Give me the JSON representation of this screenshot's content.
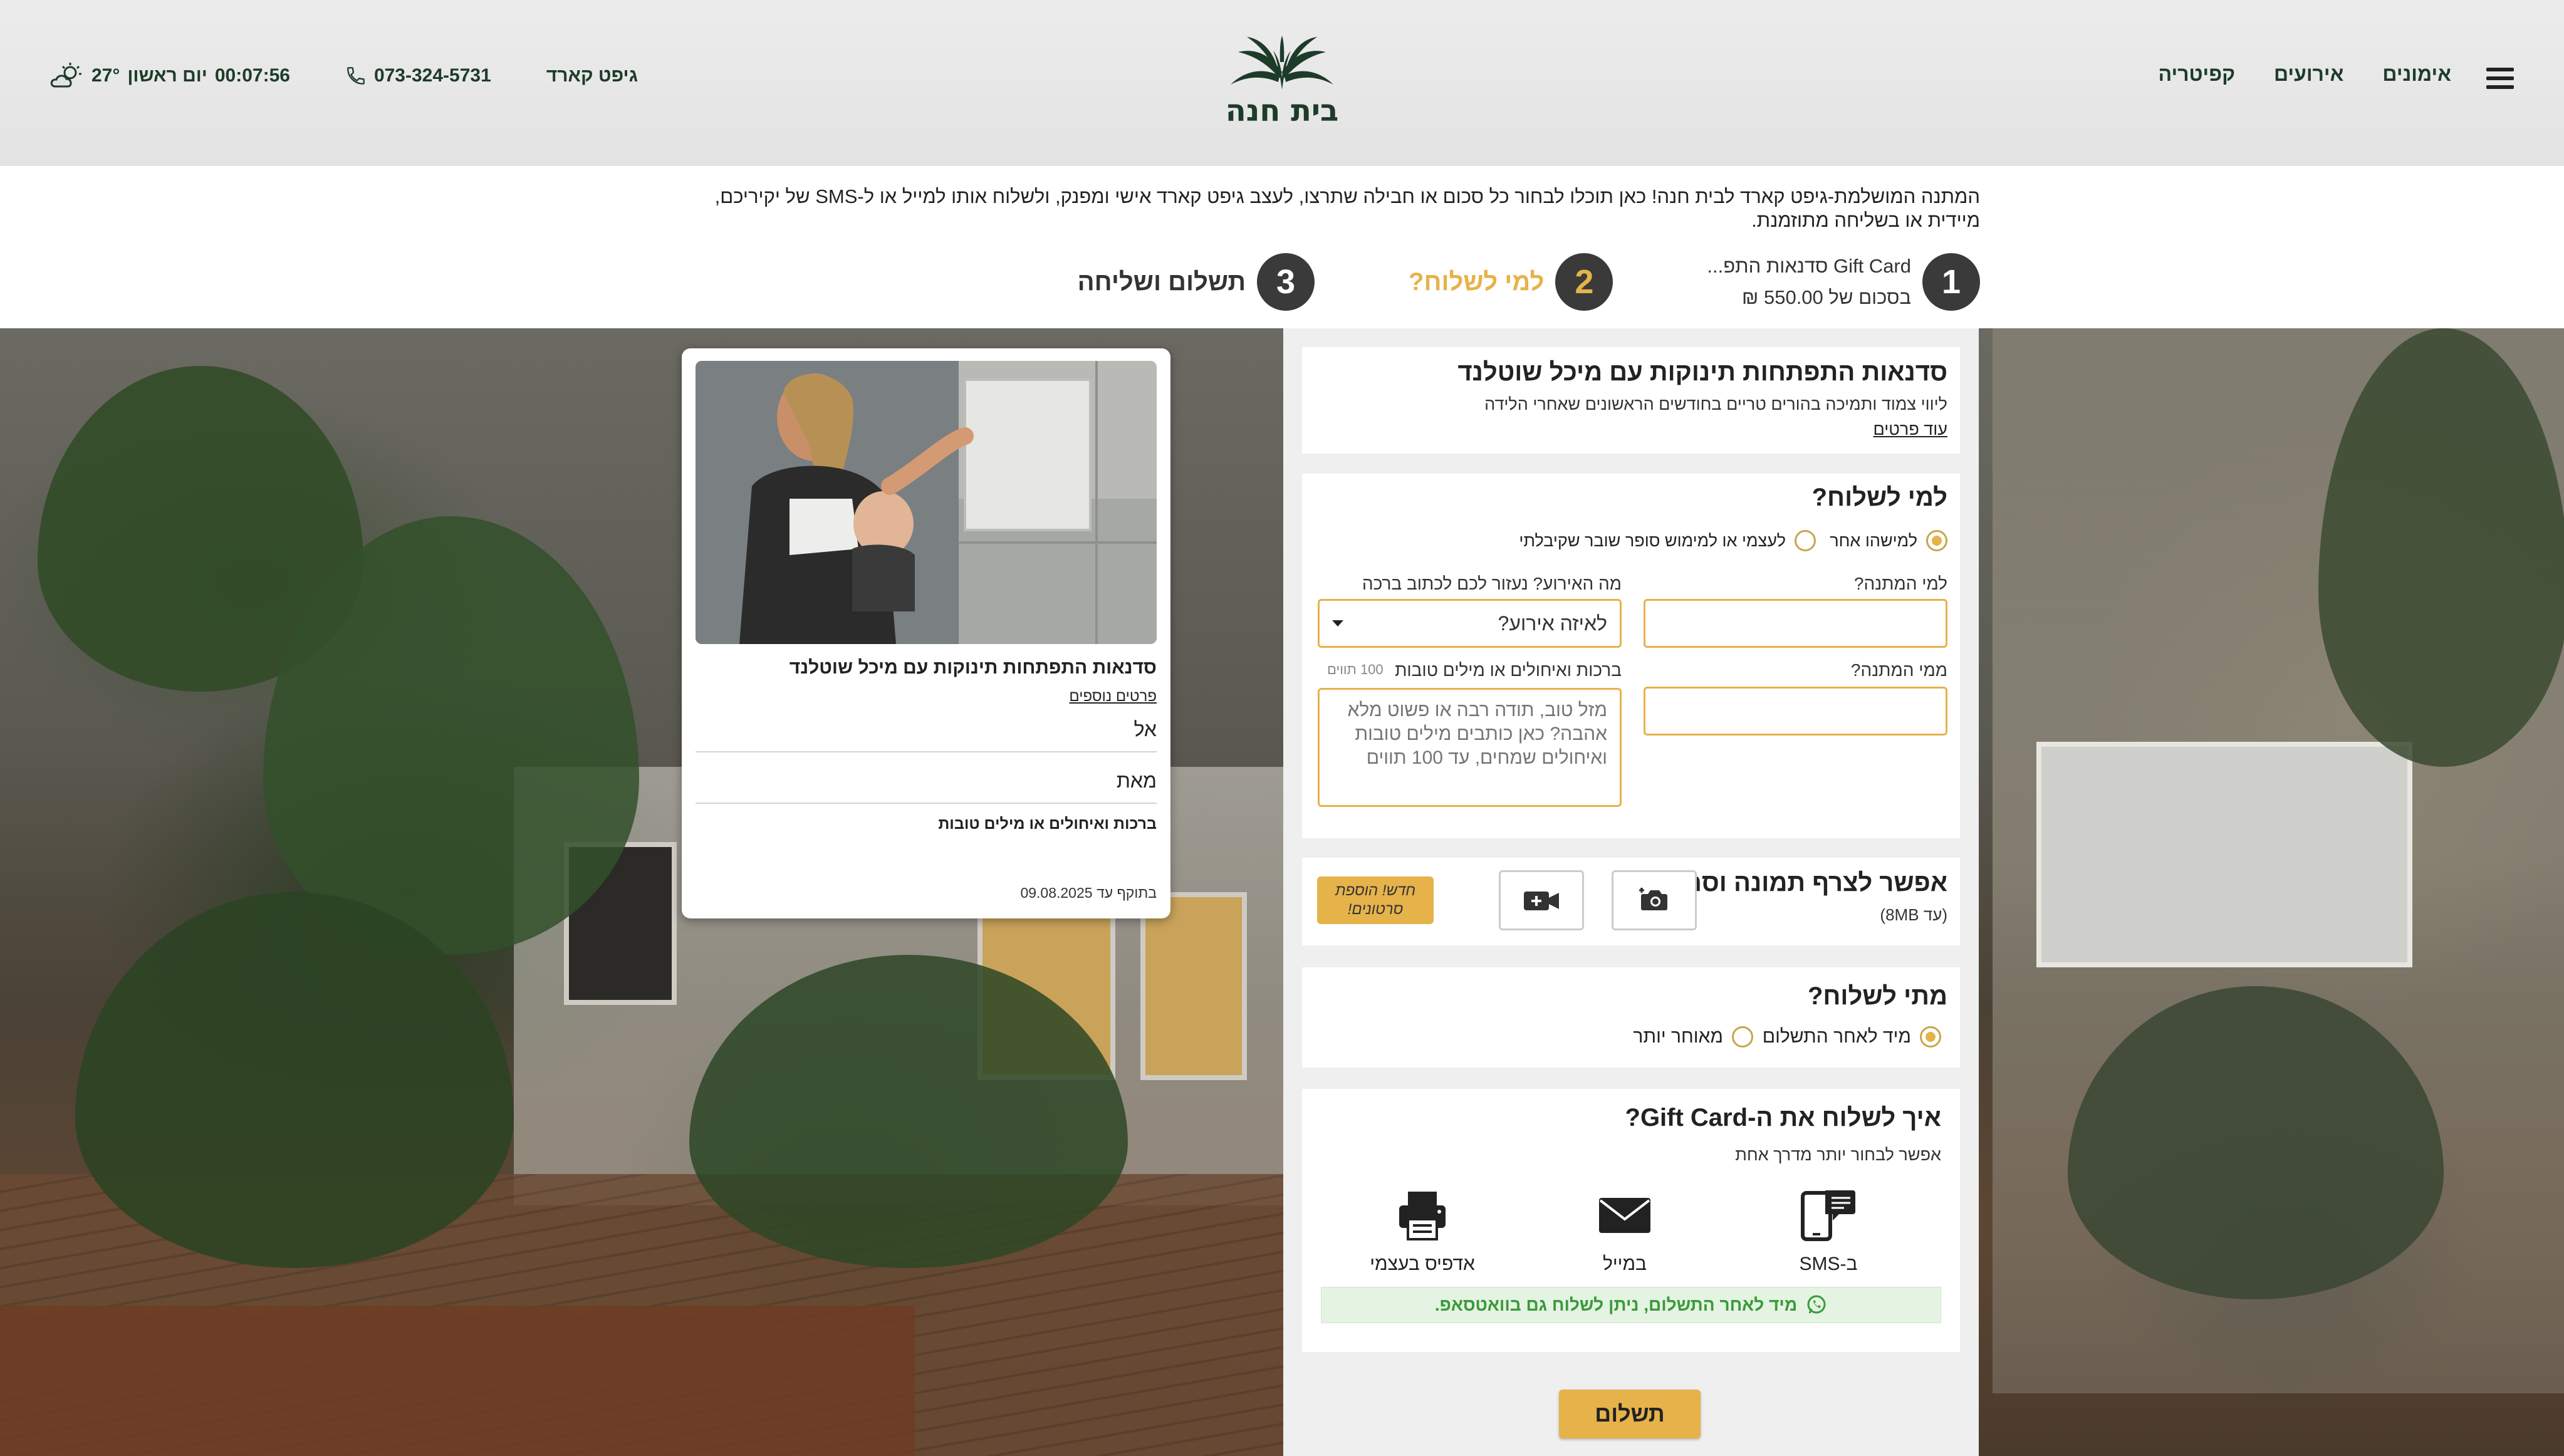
{
  "header": {
    "nav": [
      "אימונים",
      "אירועים",
      "קפיטריה"
    ],
    "gift_card_link": "גיפט קארד",
    "phone": "073-324-5731",
    "temperature": "27°",
    "day": "יום ראשון",
    "time": "00:07:56",
    "logo_text": "בית חנה"
  },
  "intro": {
    "text": "המתנה המושלמת-גיפט קארד לבית חנה! כאן תוכלו לבחור כל סכום או חבילה שתרצו, לעצב גיפט קארד אישי ומפנק, ולשלוח אותו למייל או ל-SMS של יקיריכם, מיידית או בשליחה מתוזמנת."
  },
  "steps": [
    {
      "num": "1",
      "line1": "Gift Card סדנאות התפ...",
      "line2": "בסכום של 550.00 ₪"
    },
    {
      "num": "2",
      "label": "למי לשלוח?"
    },
    {
      "num": "3",
      "label": "תשלום ושליחה"
    }
  ],
  "product": {
    "title": "סדנאות התפתחות תינוקות עם מיכל שוטלנד",
    "desc": "ליווי צמוד ותמיכה בהורים טריים בחודשים הראשונים שאחרי הלידה",
    "more": "עוד פרטים"
  },
  "recipient": {
    "title": "למי לשלוח?",
    "opt_other": "למישהו אחר",
    "opt_self": "לעצמי או למימוש סופר שובר שקיבלתי",
    "to_label": "למי המתנה?",
    "to_value": "",
    "from_label": "ממי המתנה?",
    "from_value": "",
    "event_label": "מה האירוע? נעזור לכם לכתוב ברכה",
    "event_value": "לאיזה אירוע?",
    "greeting_label": "ברכות ואיחולים או מילים טובות",
    "greeting_counter": "100 תווים",
    "greeting_placeholder": "מזל טוב, תודה רבה או פשוט מלא אהבה? כאן כותבים מילים טובות ואיחולים שמחים, עד 100 תווים"
  },
  "media": {
    "title": "אפשר לצרף תמונה וסרטון",
    "limit": "(עד 8MB)",
    "badge_line1": "חדש! הוספת",
    "badge_line2": "סרטונים!"
  },
  "when": {
    "title": "מתי לשלוח?",
    "opt_now": "מיד לאחר התשלום",
    "opt_later": "מאוחר יותר"
  },
  "how": {
    "title": "איך לשלוח את ה-Gift Card?",
    "subtitle": "אפשר לבחור יותר מדרך אחת",
    "options": [
      "ב-SMS",
      "במייל",
      "אדפיס בעצמי"
    ],
    "whatsapp_note": "מיד לאחר התשלום, ניתן לשלוח גם בוואטסאפ."
  },
  "pay_button": "תשלום",
  "preview": {
    "title": "סדנאות התפתחות תינוקות עם מיכל שוטלנד",
    "details": "פרטים נוספים",
    "to": "אל",
    "from": "מאת",
    "greeting": "ברכות ואיחולים או מילים טובות",
    "valid": "בתוקף עד 09.08.2025"
  },
  "colors": {
    "accent": "#e6b24a",
    "brand_green": "#1d3b29",
    "whatsapp_bg": "#e4f3e2",
    "whatsapp_text": "#3a9a3a"
  }
}
